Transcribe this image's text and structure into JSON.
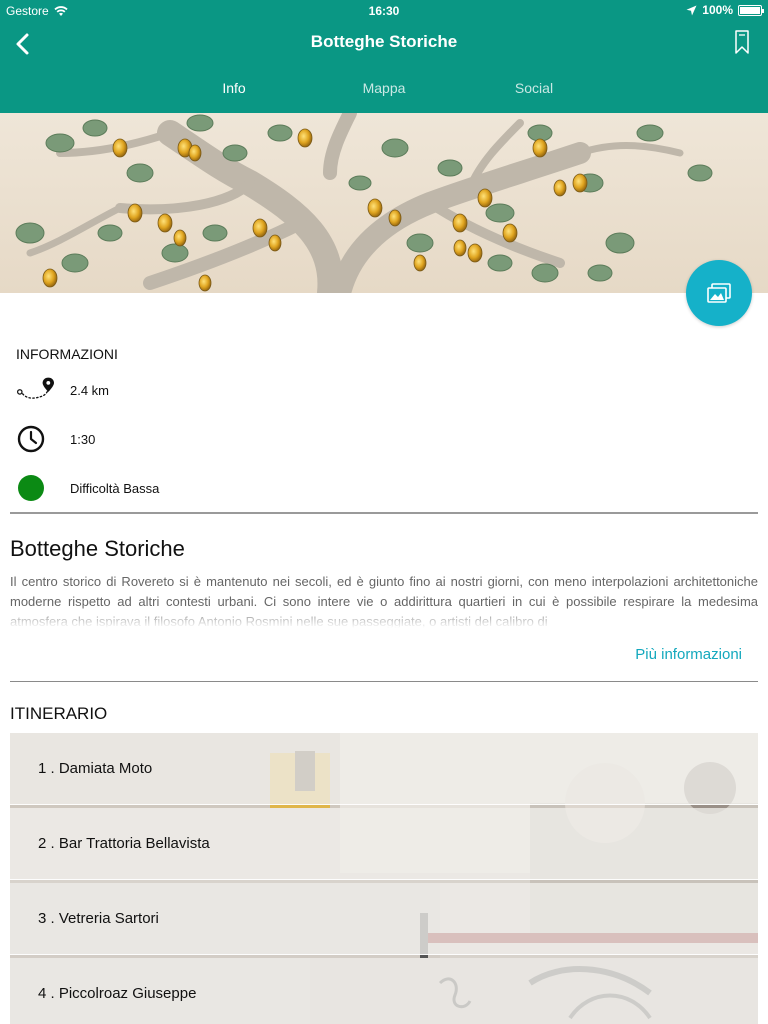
{
  "status_bar": {
    "carrier": "Gestore",
    "time": "16:30",
    "battery": "100%",
    "battery_level": 1.0
  },
  "nav": {
    "title": "Botteghe Storiche"
  },
  "tabs": [
    {
      "label": "Info",
      "active": true
    },
    {
      "label": "Mappa",
      "active": false
    },
    {
      "label": "Social",
      "active": false
    }
  ],
  "info": {
    "heading": "INFORMAZIONI",
    "distance": "2.4 km",
    "duration": "1:30",
    "difficulty": "Difficoltà Bassa"
  },
  "article": {
    "title": "Botteghe Storiche",
    "description": "Il centro storico di Rovereto si è mantenuto nei secoli, ed è giunto fino ai nostri giorni, con meno interpolazioni architettoniche moderne rispetto ad altri contesti urbani. Ci sono intere vie o addirittura quartieri in cui è possibile respirare la medesima atmosfera che ispirava il filosofo Antonio Rosmini nelle sue passeggiate, o artisti del calibro di",
    "more_label": "Più informazioni"
  },
  "itinerary": {
    "heading": "ITINERARIO",
    "items": [
      {
        "label": "1 . Damiata Moto"
      },
      {
        "label": "2 . Bar Trattoria Bellavista"
      },
      {
        "label": "3 . Vetreria Sartori"
      },
      {
        "label": "4 . Piccolroaz Giuseppe"
      }
    ]
  },
  "colors": {
    "header": "#0a9784",
    "accent": "#13a8bd",
    "fab": "#15b1c9",
    "difficulty_low": "#0b8a14"
  },
  "icons": [
    "back-chevron-icon",
    "bookmark-icon",
    "gallery-icon",
    "route-pin-icon",
    "clock-icon",
    "difficulty-dot-icon",
    "wifi-icon",
    "location-arrow-icon",
    "battery-icon"
  ]
}
